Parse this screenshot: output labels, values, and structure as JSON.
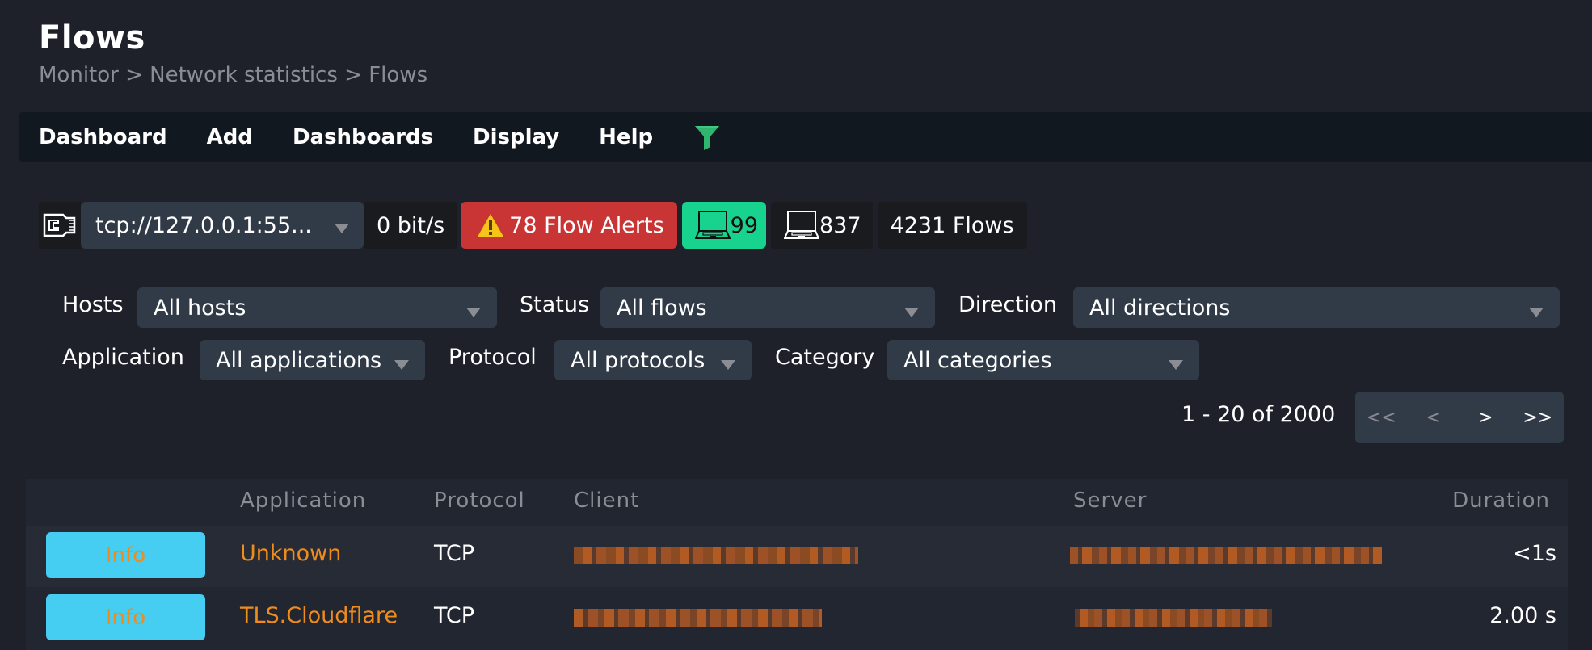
{
  "page": {
    "title": "Flows",
    "breadcrumb": [
      "Monitor",
      "Network statistics",
      "Flows"
    ],
    "breadcrumb_separator": ">"
  },
  "menu": {
    "items": [
      {
        "label": "Dashboard"
      },
      {
        "label": "Add"
      },
      {
        "label": "Dashboards"
      },
      {
        "label": "Display"
      },
      {
        "label": "Help"
      }
    ],
    "filter_icon": "filter-icon",
    "filter_icon_color": "#2fb56e"
  },
  "toolbar": {
    "interface_icon": "network-port-icon",
    "interface_value": "tcp://127.0.0.1:55...",
    "throughput": "0 bit/s",
    "alerts": {
      "icon": "warning-icon",
      "label": "78 Flow Alerts",
      "color": "#c93434"
    },
    "local_hosts": {
      "icon": "laptop-icon",
      "count": "99",
      "color": "#17d38d"
    },
    "all_hosts": {
      "icon": "laptop-icon",
      "count": "837"
    },
    "flows_count": "4231 Flows"
  },
  "filters": {
    "hosts": {
      "label": "Hosts",
      "value": "All hosts"
    },
    "status": {
      "label": "Status",
      "value": "All flows"
    },
    "direction": {
      "label": "Direction",
      "value": "All directions"
    },
    "application": {
      "label": "Application",
      "value": "All applications"
    },
    "protocol": {
      "label": "Protocol",
      "value": "All protocols"
    },
    "category": {
      "label": "Category",
      "value": "All categories"
    }
  },
  "pagination": {
    "summary": "1 - 20 of 2000",
    "first": "<<",
    "prev": "<",
    "next": ">",
    "last": ">>"
  },
  "table": {
    "columns": [
      "",
      "Application",
      "Protocol",
      "Client",
      "Server",
      "Duration"
    ],
    "rows": [
      {
        "action": "Info",
        "application": "Unknown",
        "protocol": "TCP",
        "client": "[redacted]",
        "server": "[redacted]",
        "duration": "<1s"
      },
      {
        "action": "Info",
        "application": "TLS.Cloudflare",
        "protocol": "TCP",
        "client": "[redacted]",
        "server": "[redacted]",
        "duration": "2.00 s"
      }
    ]
  },
  "colors": {
    "background": "#1e212a",
    "menubar": "#121820",
    "select_bg": "#313a47",
    "info_button": "#45cdf2",
    "link_orange": "#f08c1c",
    "muted_text": "#8a8d93"
  }
}
